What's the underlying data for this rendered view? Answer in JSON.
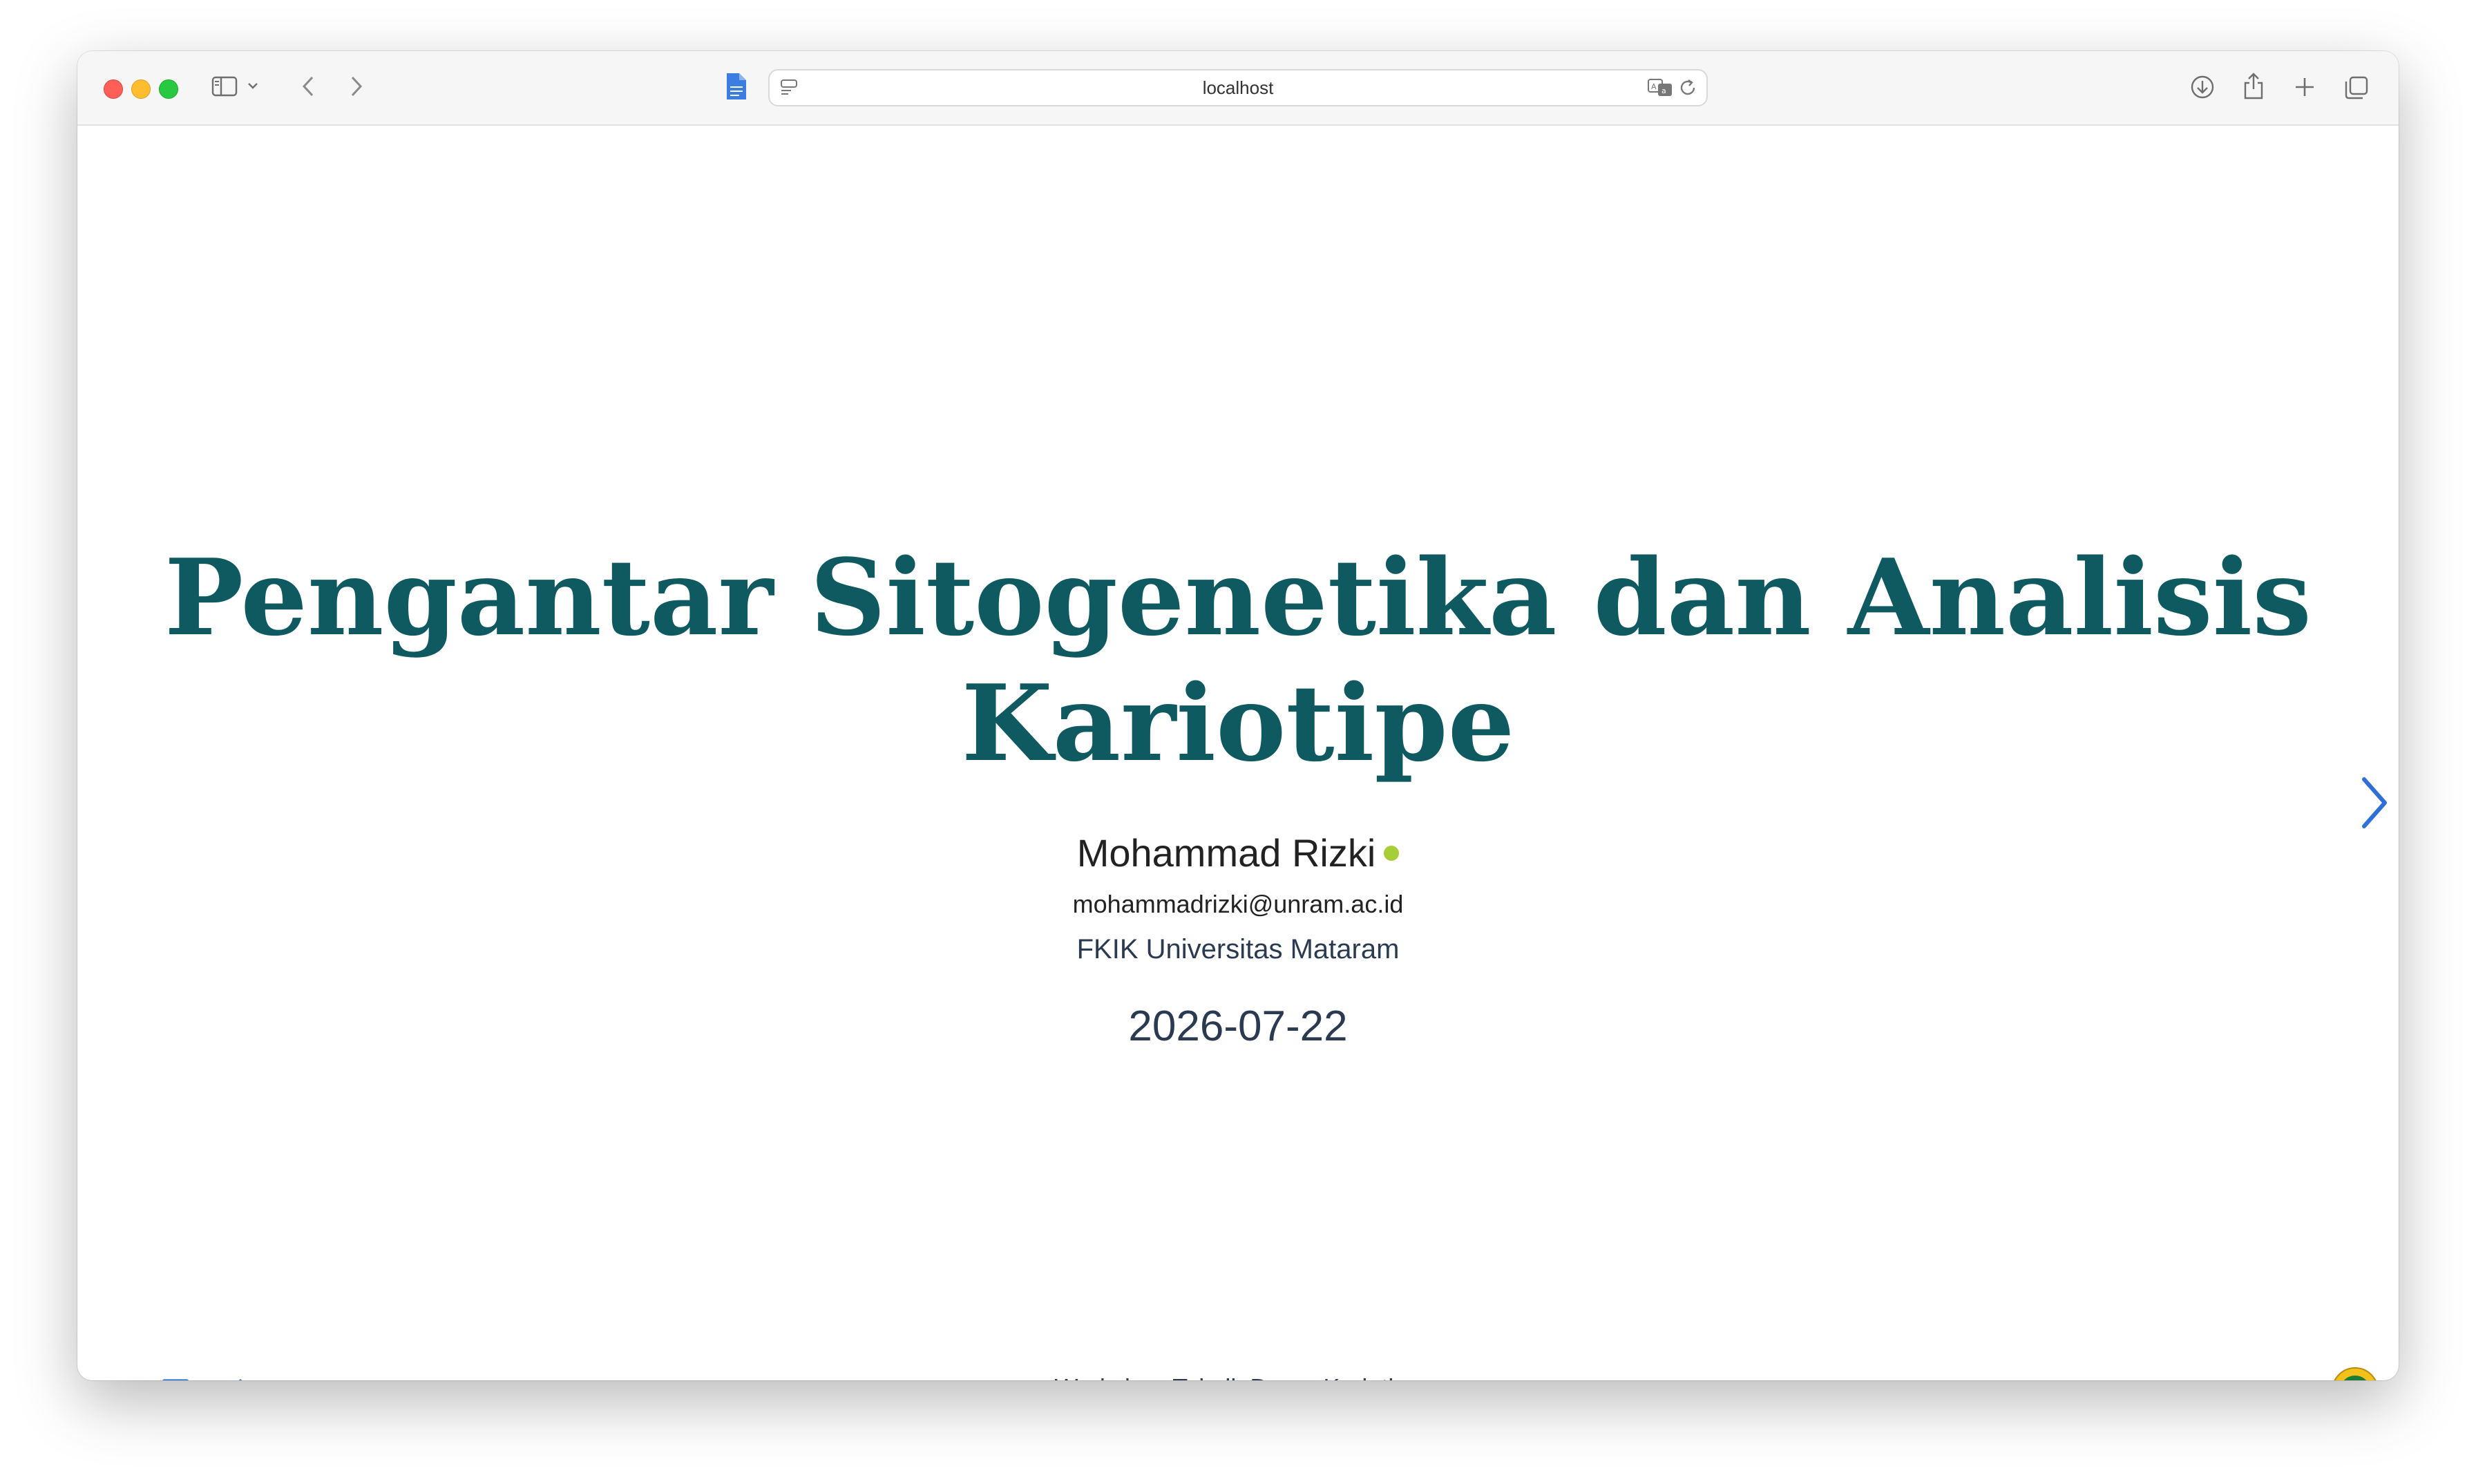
{
  "browser": {
    "url": "localhost"
  },
  "slide": {
    "title": "Pengantar Sitogenetika dan Analisis Kariotipe",
    "author": "Mohammad Rizki",
    "email": "mohammadrizki@unram.ac.id",
    "affiliation": "FKIK Universitas Mataram",
    "date": "2026-07-22"
  },
  "footer": {
    "text": "Workshop Teknik Dasar Kariotipe"
  },
  "colors": {
    "title": "#0f5a60",
    "accent": "#2f6fd8",
    "orcid": "#a6ce39"
  },
  "icons": {
    "sidebar": "sidebar-icon",
    "back": "chevron-left-icon",
    "forward": "chevron-right-icon",
    "translate": "translate-icon",
    "reload": "reload-icon",
    "download": "download-icon",
    "share": "share-icon",
    "new_tab": "plus-icon",
    "tabs": "tab-overview-icon",
    "menu": "menu-icon",
    "slides": "presentation-icon",
    "draw": "pen-icon"
  }
}
